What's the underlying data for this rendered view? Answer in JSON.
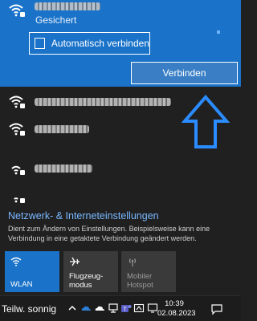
{
  "selected_network": {
    "status": "Gesichert",
    "auto_connect_label": "Automatisch verbinden",
    "auto_connect_checked": false,
    "connect_label": "Verbinden"
  },
  "networks": [
    {
      "secured": true
    },
    {
      "secured": true
    },
    {
      "secured": true
    },
    {
      "secured": true
    }
  ],
  "settings": {
    "link_label": "Netzwerk- & Interneteinstellungen",
    "description": "Dient zum Ändern von Einstellungen. Beispielsweise kann eine Verbindung in eine getaktete Verbindung geändert werden."
  },
  "quick_toggles": [
    {
      "label": "WLAN",
      "icon": "wifi-icon",
      "active": true
    },
    {
      "label": "Flugzeug-\nmodus",
      "icon": "airplane-icon",
      "active": false
    },
    {
      "label": "Mobiler\nHotspot",
      "icon": "hotspot-icon",
      "active": false,
      "disabled": true
    }
  ],
  "taskbar": {
    "weather": "Teilw. sonnig",
    "time": "10:39",
    "date": "02.08.2023",
    "tray_icons": [
      "chevron-up-icon",
      "onedrive-icon",
      "onedrive-icon",
      "network-icon",
      "teams-icon",
      "security-icon",
      "display-icon",
      "wifi-icon"
    ]
  },
  "colors": {
    "accent": "#1a73c9",
    "link": "#79b8ff",
    "annotation_arrow": "#2b8cff"
  }
}
